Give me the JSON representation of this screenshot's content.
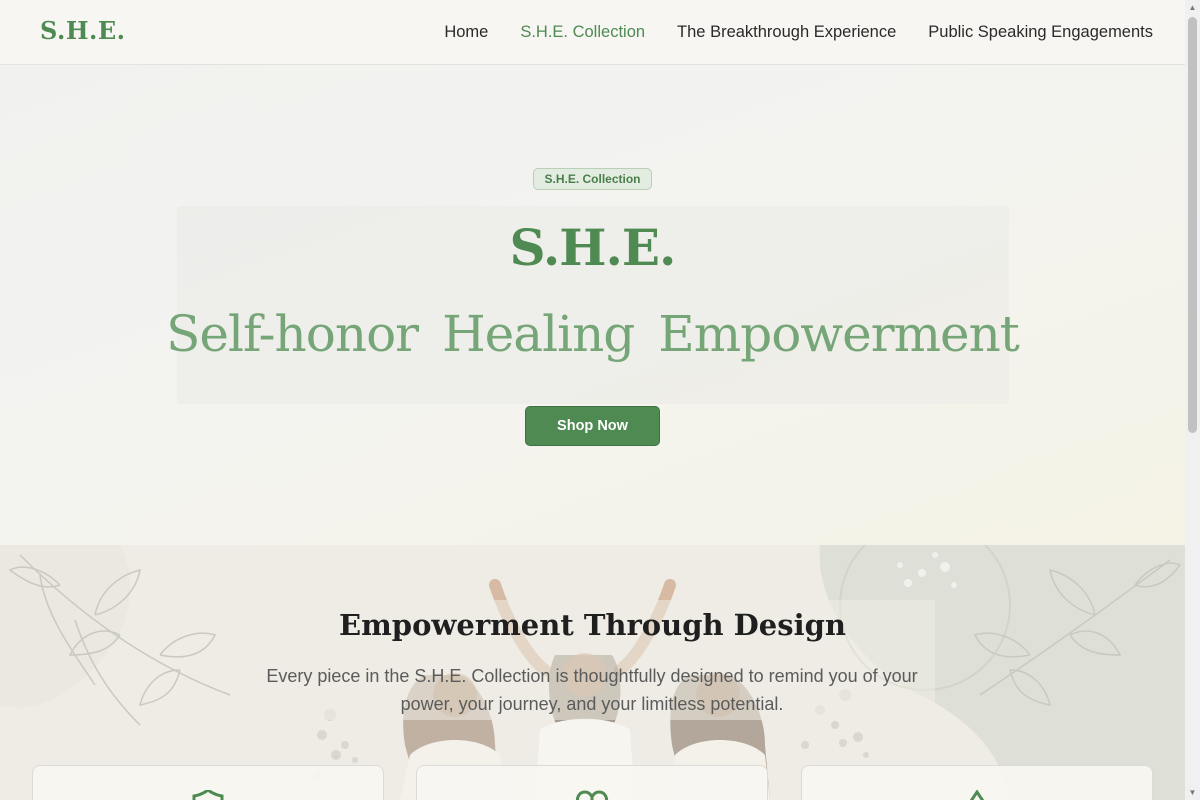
{
  "brand": "S.H.E.",
  "nav": {
    "items": [
      {
        "label": "Home",
        "active": false
      },
      {
        "label": "S.H.E. Collection",
        "active": true
      },
      {
        "label": "The Breakthrough Experience",
        "active": false
      },
      {
        "label": "Public Speaking Engagements",
        "active": false
      }
    ]
  },
  "hero": {
    "badge": "S.H.E. Collection",
    "title": "S.H.E.",
    "words": [
      "Self-honor",
      "Healing",
      "Empowerment"
    ],
    "button": "Shop Now"
  },
  "section": {
    "title": "Empowerment Through Design",
    "subtitle": "Every piece in the S.H.E. Collection is thoughtfully designed to remind you of your power, your journey, and your limitless potential."
  },
  "cards": [
    {
      "icon": "shield-icon"
    },
    {
      "icon": "heart-icon"
    },
    {
      "icon": "mountain-icon"
    }
  ],
  "colors": {
    "accent": "#4e8a52",
    "accent_light": "#76a677",
    "background": "#f6f5f1"
  }
}
